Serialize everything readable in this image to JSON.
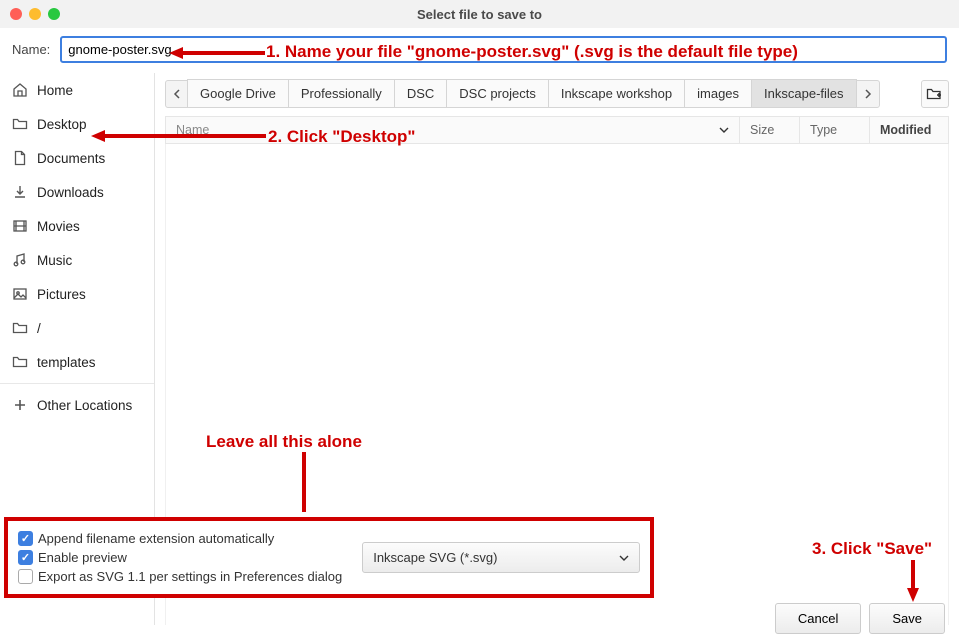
{
  "window_title": "Select file to save to",
  "name_label": "Name:",
  "filename": "gnome-poster.svg",
  "sidebar": {
    "items": [
      {
        "label": "Home",
        "icon": "home-icon"
      },
      {
        "label": "Desktop",
        "icon": "folder-icon"
      },
      {
        "label": "Documents",
        "icon": "document-icon"
      },
      {
        "label": "Downloads",
        "icon": "download-icon"
      },
      {
        "label": "Movies",
        "icon": "movie-icon"
      },
      {
        "label": "Music",
        "icon": "music-icon"
      },
      {
        "label": "Pictures",
        "icon": "picture-icon"
      },
      {
        "label": "/",
        "icon": "folder-icon"
      },
      {
        "label": "templates",
        "icon": "folder-icon"
      }
    ],
    "other_locations": "Other Locations"
  },
  "breadcrumbs": [
    "Google Drive",
    "Professionally",
    "DSC",
    "DSC projects",
    "Inkscape workshop",
    "images",
    "Inkscape-files"
  ],
  "columns": {
    "name": "Name",
    "size": "Size",
    "type": "Type",
    "modified": "Modified"
  },
  "options": {
    "append_ext": "Append filename extension automatically",
    "enable_preview": "Enable preview",
    "export_svg11": "Export as SVG 1.1 per settings in Preferences dialog",
    "format": "Inkscape SVG (*.svg)"
  },
  "buttons": {
    "cancel": "Cancel",
    "save": "Save"
  },
  "annotations": {
    "a1": "1. Name your file \"gnome-poster.svg\" (.svg is the default file type)",
    "a2": "2. Click \"Desktop\"",
    "a3": "Leave all this alone",
    "a4": "3. Click \"Save\""
  }
}
